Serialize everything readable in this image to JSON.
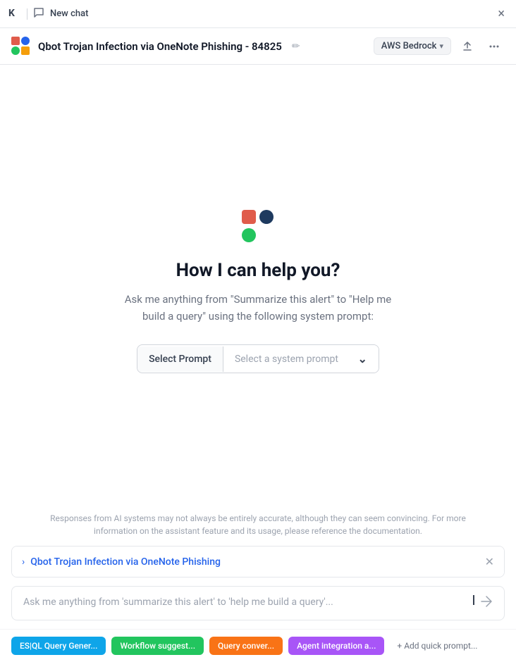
{
  "topbar": {
    "logo": "K",
    "new_chat_label": "New chat",
    "close_label": "×"
  },
  "header": {
    "title": "Qbot Trojan Infection via OneNote Phishing - 84825",
    "provider_label": "AWS Bedrock",
    "edit_icon": "edit-icon",
    "share_icon": "share-icon",
    "more_icon": "more-icon"
  },
  "welcome": {
    "heading": "How I can help you?",
    "subtitle": "Ask me anything from \"Summarize this alert\" to \"Help me build a query\" using the following system prompt:",
    "select_label": "Select Prompt",
    "select_placeholder": "Select a system prompt"
  },
  "disclaimer": {
    "text": "Responses from AI systems may not always be entirely accurate, although they can seem convincing. For more information on the assistant feature and its usage, please reference the documentation."
  },
  "alert_panel": {
    "title": "Qbot Trojan Infection via OneNote Phishing",
    "close_icon": "close-icon"
  },
  "chat_input": {
    "placeholder": "Ask me anything from 'summarize this alert' to 'help me build a query'..."
  },
  "quick_prompts": [
    {
      "label": "ES|QL Query Gener...",
      "color": "chip-esql"
    },
    {
      "label": "Workflow suggest...",
      "color": "chip-workflow"
    },
    {
      "label": "Query conver...",
      "color": "chip-query"
    },
    {
      "label": "Agent integration a...",
      "color": "chip-agent"
    }
  ],
  "add_prompt": {
    "label": "+ Add quick prompt..."
  }
}
